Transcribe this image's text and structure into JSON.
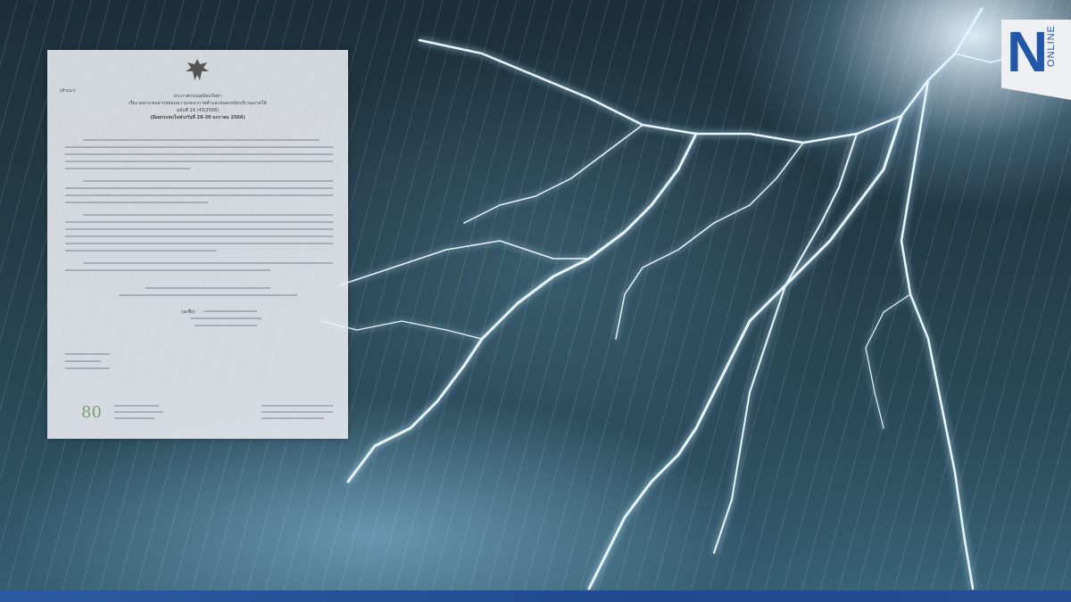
{
  "brand": {
    "letter": "N",
    "word": "ONLINE",
    "accent": "#2256a8"
  },
  "document": {
    "label": "(สำเนา)",
    "heading": "ประกาศกรมอุตุนิยมวิทยา",
    "subject": "เรื่อง ผลกระทบจากหย่อมความกดอากาศต่ำและฝนตกหนักบริเวณภาคใต้",
    "number": "ฉบับที่ 19 (40/2566)",
    "period": "(มีผลกระทบในช่วงวันที่ 28-30 มกราคม 2566)",
    "signer_label": "(ลงชื่อ)",
    "footer_logo": "80"
  },
  "colors": {
    "bottom_bar": "#2c5aa0",
    "document_bg": "#eceef2"
  }
}
